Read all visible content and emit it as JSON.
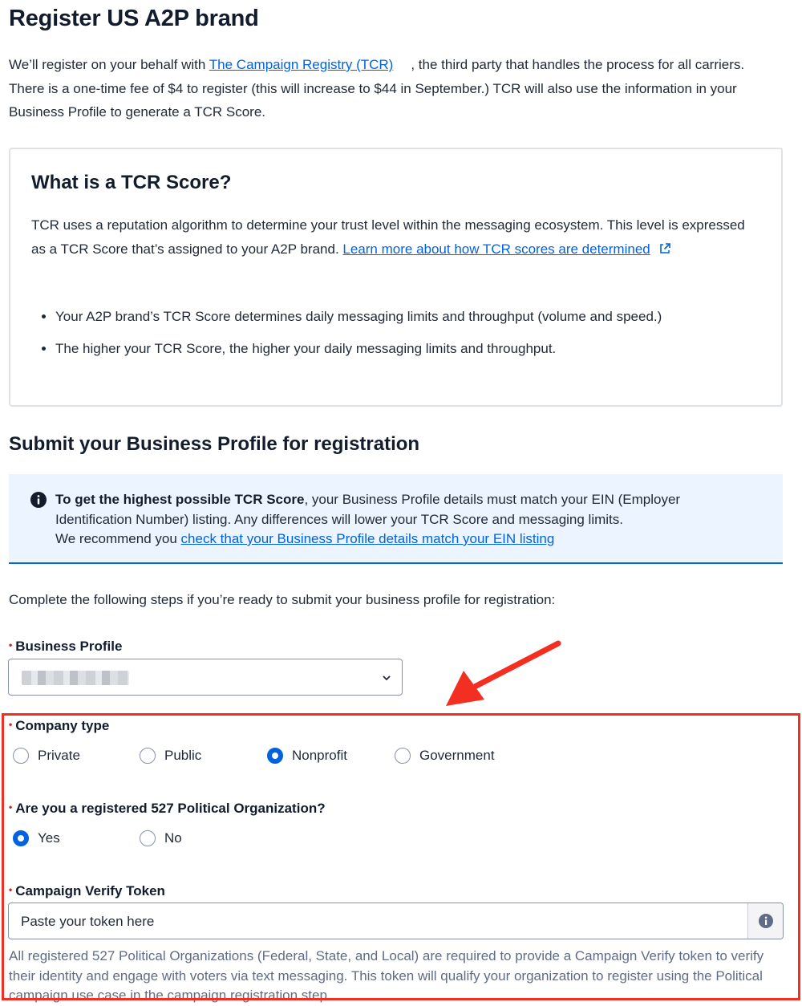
{
  "page": {
    "title": "Register US A2P brand",
    "intro_before_link": "We’ll register on your behalf with ",
    "intro_link": "The Campaign Registry (TCR)",
    "intro_after_link": ", the third party that handles the process for all carriers. There is a one-time fee of $4 to register (this will increase to $44 in September.) TCR will also use the information in your Business Profile to generate a TCR Score."
  },
  "score_card": {
    "title": "What is a TCR Score?",
    "desc": "TCR uses a reputation algorithm to determine your trust level within the messaging ecosystem. This level is expressed as a TCR Score that’s assigned to your A2P brand. ",
    "link": "Learn more about how TCR scores are determined",
    "bullets": [
      "Your A2P brand’s TCR Score determines daily messaging limits and throughput (volume and speed.)",
      "The higher your TCR Score, the higher your daily messaging limits and throughput."
    ]
  },
  "submit_section": {
    "title": "Submit your Business Profile for registration",
    "info_bold": "To get the highest possible TCR Score",
    "info_text": ", your Business Profile details must match your EIN (Employer Identification Number) listing. Any differences will lower your TCR Score and messaging limits.",
    "info_recommend": "We recommend you ",
    "info_link": "check that your Business Profile details match your EIN listing",
    "steps_text": "Complete the following steps if you’re ready to submit your business profile for registration:"
  },
  "form": {
    "required_mark": "•",
    "business_profile": {
      "label": "Business Profile"
    },
    "company_type": {
      "label": "Company type",
      "options": [
        "Private",
        "Public",
        "Nonprofit",
        "Government"
      ],
      "selected": "Nonprofit"
    },
    "political_org": {
      "label": "Are you a registered 527 Political Organization?",
      "options": [
        "Yes",
        "No"
      ],
      "selected": "Yes"
    },
    "campaign_token": {
      "label": "Campaign Verify Token",
      "placeholder": "Paste your token here",
      "help": "All registered 527 Political Organizations (Federal, State, and Local) are required to provide a Campaign Verify token to verify their identity and engage with voters via text messaging. This token will qualify your organization to register using the Political campaign use case in the campaign registration step."
    }
  },
  "colors": {
    "link": "#0263e0",
    "radio_checked": "#0263e0",
    "required": "#d61f1f",
    "annotation": "#f22f20",
    "info_bg": "#ebf4ff"
  }
}
